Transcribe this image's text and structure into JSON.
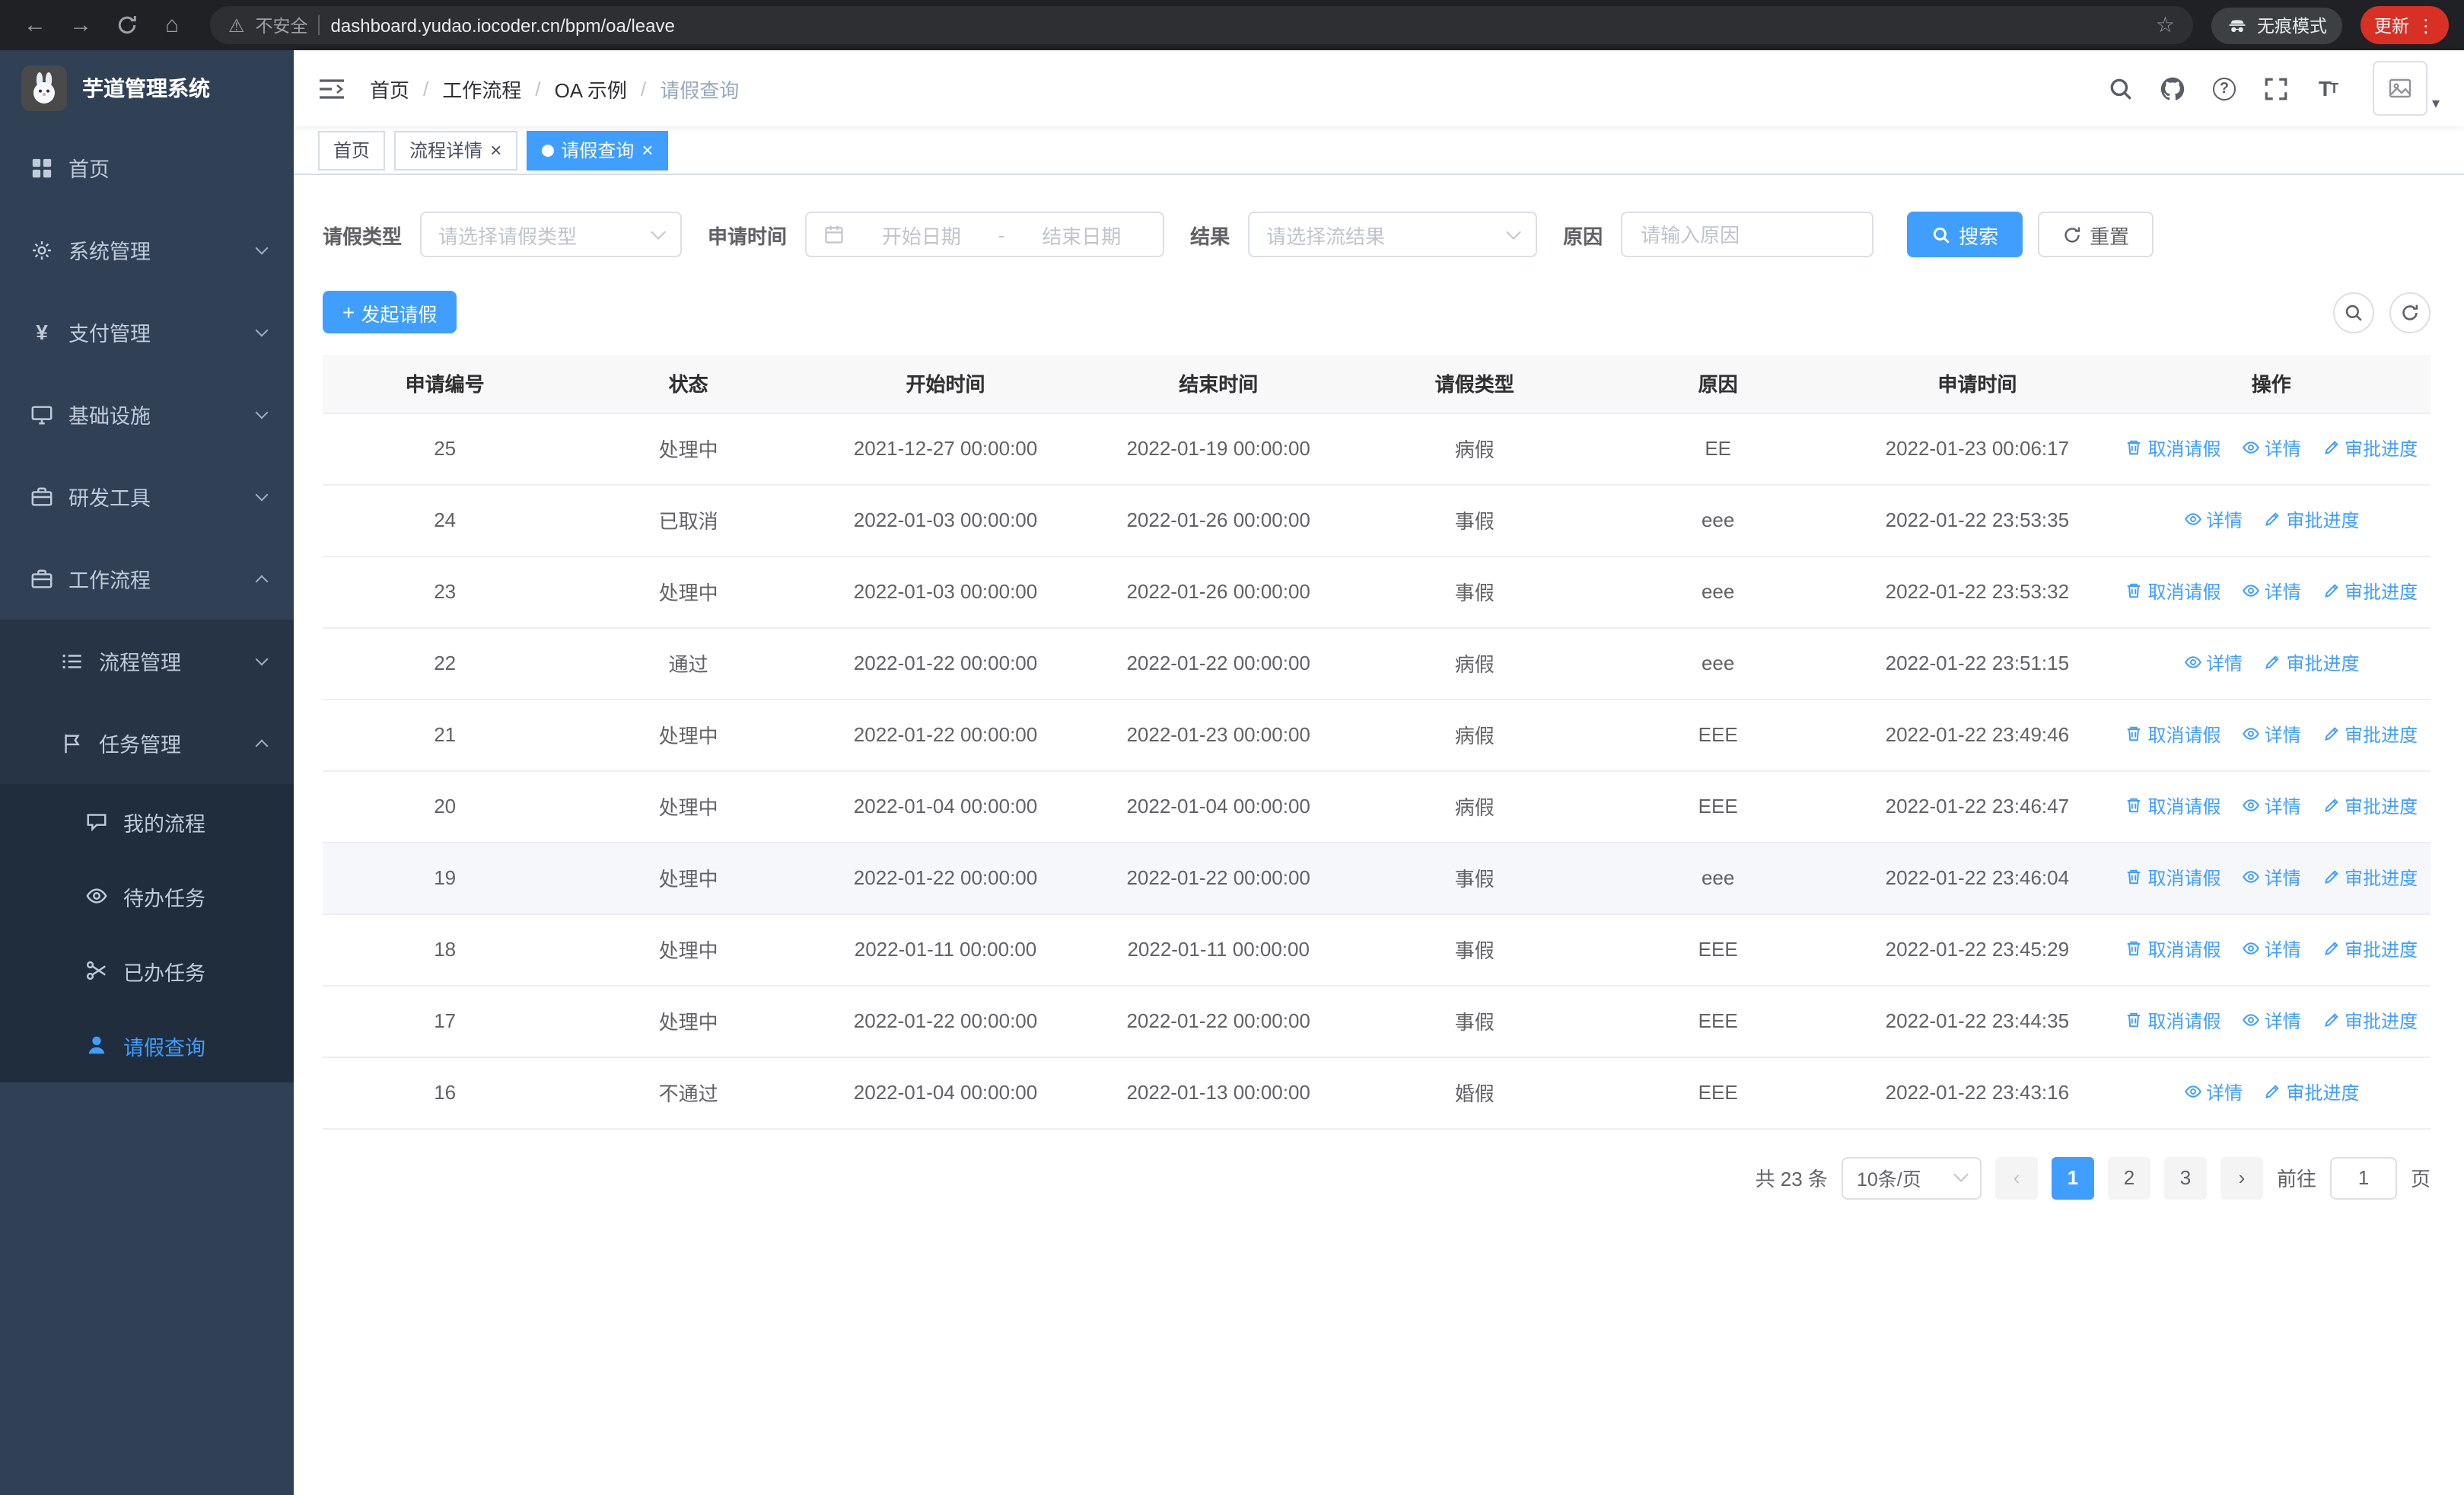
{
  "colors": {
    "accent": "#409eff",
    "sidebar_bg": "#304156",
    "update_badge": "#d93025"
  },
  "icons": {
    "back": "←",
    "forward": "→",
    "home": "⌂",
    "warning": "⚠",
    "star": "☆",
    "kebab": "⋮",
    "caret": "▾",
    "close": "×",
    "yen": "¥",
    "help": "?",
    "prev": "‹",
    "next": "›",
    "plus": "+",
    "font_large": "T",
    "font_small": "T"
  },
  "browser": {
    "security_warning": "不安全",
    "url": "dashboard.yudao.iocoder.cn/bpm/oa/leave",
    "incognito_label": "无痕模式",
    "update_label": "更新"
  },
  "sidebar": {
    "logo_title": "芋道管理系统",
    "items": [
      {
        "label": "首页"
      },
      {
        "label": "系统管理"
      },
      {
        "label": "支付管理"
      },
      {
        "label": "基础设施"
      },
      {
        "label": "研发工具"
      },
      {
        "label": "工作流程"
      },
      {
        "label": "流程管理"
      },
      {
        "label": "任务管理"
      },
      {
        "label": "我的流程"
      },
      {
        "label": "待办任务"
      },
      {
        "label": "已办任务"
      },
      {
        "label": "请假查询"
      }
    ]
  },
  "header": {
    "breadcrumb": [
      "首页",
      "工作流程",
      "OA 示例",
      "请假查询"
    ],
    "breadcrumb_separator": "/"
  },
  "tabs": [
    {
      "label": "首页"
    },
    {
      "label": "流程详情"
    },
    {
      "label": "请假查询"
    }
  ],
  "filters": {
    "leave_type_label": "请假类型",
    "leave_type_placeholder": "请选择请假类型",
    "apply_time_label": "申请时间",
    "start_date_placeholder": "开始日期",
    "range_separator": "-",
    "end_date_placeholder": "结束日期",
    "result_label": "结果",
    "result_placeholder": "请选择流结果",
    "reason_label": "原因",
    "reason_placeholder": "请输入原因",
    "search_button": "搜索",
    "reset_button": "重置"
  },
  "toolbar": {
    "create_button": "发起请假"
  },
  "table": {
    "columns": [
      "申请编号",
      "状态",
      "开始时间",
      "结束时间",
      "请假类型",
      "原因",
      "申请时间",
      "操作"
    ],
    "action_labels": {
      "cancel": "取消请假",
      "detail": "详情",
      "progress": "审批进度"
    },
    "rows": [
      {
        "id": "25",
        "status": "处理中",
        "start": "2021-12-27 00:00:00",
        "end": "2022-01-19 00:00:00",
        "type": "病假",
        "reason": "EE",
        "apply_time": "2022-01-23 00:06:17",
        "cancellable": true,
        "highlighted": false
      },
      {
        "id": "24",
        "status": "已取消",
        "start": "2022-01-03 00:00:00",
        "end": "2022-01-26 00:00:00",
        "type": "事假",
        "reason": "eee",
        "apply_time": "2022-01-22 23:53:35",
        "cancellable": false,
        "highlighted": false
      },
      {
        "id": "23",
        "status": "处理中",
        "start": "2022-01-03 00:00:00",
        "end": "2022-01-26 00:00:00",
        "type": "事假",
        "reason": "eee",
        "apply_time": "2022-01-22 23:53:32",
        "cancellable": true,
        "highlighted": false
      },
      {
        "id": "22",
        "status": "通过",
        "start": "2022-01-22 00:00:00",
        "end": "2022-01-22 00:00:00",
        "type": "病假",
        "reason": "eee",
        "apply_time": "2022-01-22 23:51:15",
        "cancellable": false,
        "highlighted": false
      },
      {
        "id": "21",
        "status": "处理中",
        "start": "2022-01-22 00:00:00",
        "end": "2022-01-23 00:00:00",
        "type": "病假",
        "reason": "EEE",
        "apply_time": "2022-01-22 23:49:46",
        "cancellable": true,
        "highlighted": false
      },
      {
        "id": "20",
        "status": "处理中",
        "start": "2022-01-04 00:00:00",
        "end": "2022-01-04 00:00:00",
        "type": "病假",
        "reason": "EEE",
        "apply_time": "2022-01-22 23:46:47",
        "cancellable": true,
        "highlighted": false
      },
      {
        "id": "19",
        "status": "处理中",
        "start": "2022-01-22 00:00:00",
        "end": "2022-01-22 00:00:00",
        "type": "事假",
        "reason": "eee",
        "apply_time": "2022-01-22 23:46:04",
        "cancellable": true,
        "highlighted": true
      },
      {
        "id": "18",
        "status": "处理中",
        "start": "2022-01-11 00:00:00",
        "end": "2022-01-11 00:00:00",
        "type": "事假",
        "reason": "EEE",
        "apply_time": "2022-01-22 23:45:29",
        "cancellable": true,
        "highlighted": false
      },
      {
        "id": "17",
        "status": "处理中",
        "start": "2022-01-22 00:00:00",
        "end": "2022-01-22 00:00:00",
        "type": "事假",
        "reason": "EEE",
        "apply_time": "2022-01-22 23:44:35",
        "cancellable": true,
        "highlighted": false
      },
      {
        "id": "16",
        "status": "不通过",
        "start": "2022-01-04 00:00:00",
        "end": "2022-01-13 00:00:00",
        "type": "婚假",
        "reason": "EEE",
        "apply_time": "2022-01-22 23:43:16",
        "cancellable": false,
        "highlighted": false
      }
    ]
  },
  "pagination": {
    "total": "共 23 条",
    "page_size": "10条/页",
    "pages": [
      "1",
      "2",
      "3"
    ],
    "active_page": "1",
    "goto_label": "前往",
    "goto_value": "1",
    "page_unit": "页"
  }
}
